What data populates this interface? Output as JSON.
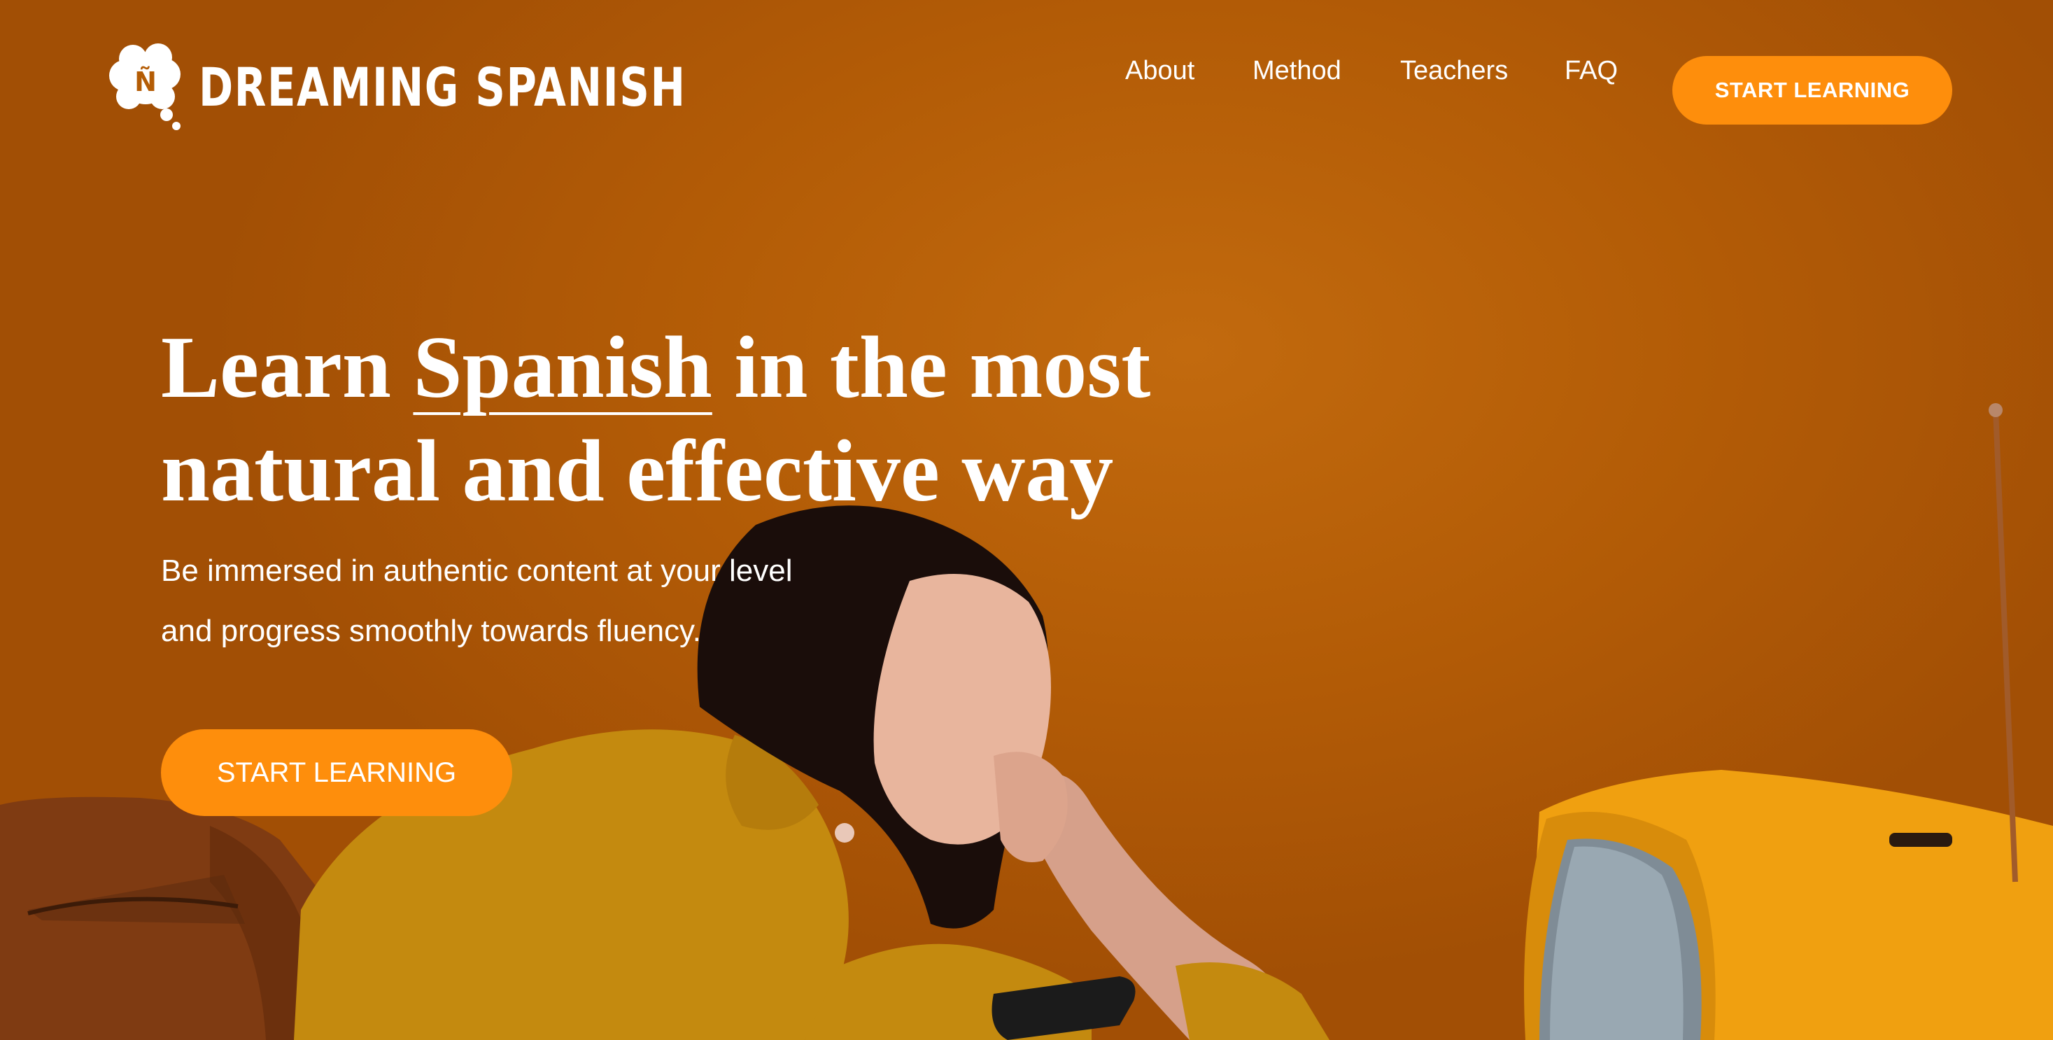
{
  "brand": {
    "logo_text": "DREAMING SPANISH",
    "logo_glyph": "Ñ"
  },
  "nav": {
    "items": [
      {
        "label": "About"
      },
      {
        "label": "Method"
      },
      {
        "label": "Teachers"
      },
      {
        "label": "FAQ"
      }
    ],
    "cta_label": "START LEARNING"
  },
  "hero": {
    "headline": {
      "part1": "Learn ",
      "highlight": "Spanish",
      "part2": " in the most natural and effective way"
    },
    "subtitle_line1": "Be immersed in authentic content at your level",
    "subtitle_line2": "and progress smoothly towards fluency.",
    "cta_label": "START LEARNING"
  },
  "colors": {
    "background": "#b45c05",
    "accent": "#fe8e0c",
    "text": "#ffffff"
  },
  "icons": [
    "thought-cloud-logo-icon"
  ]
}
